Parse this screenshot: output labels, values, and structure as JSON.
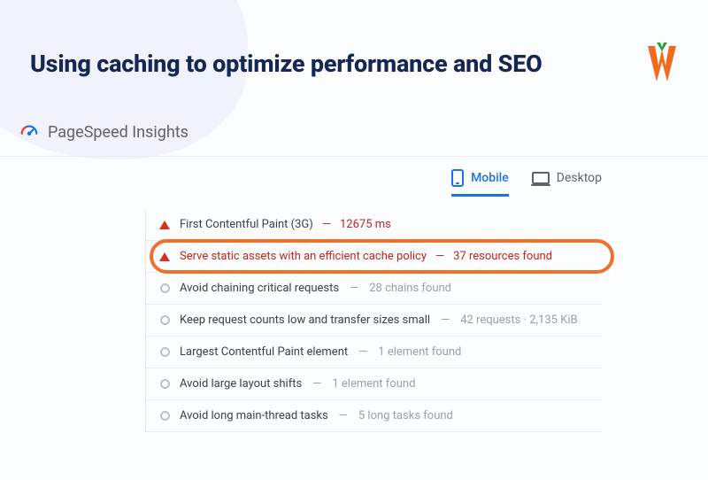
{
  "title": "Using caching to optimize performance and SEO",
  "brand_icon": "w-carrot-icon",
  "psi": {
    "label": "PageSpeed Insights",
    "icon": "pagespeed-icon"
  },
  "tabs": {
    "mobile": {
      "label": "Mobile",
      "active": true
    },
    "desktop": {
      "label": "Desktop",
      "active": false
    }
  },
  "audits": [
    {
      "severity": "warn",
      "title": "First Contentful Paint (3G)",
      "detail": "12675 ms",
      "detail_style": "red",
      "highlighted": false
    },
    {
      "severity": "warn",
      "title": "Serve static assets with an efficient cache policy",
      "detail": "37 resources found",
      "detail_style": "red",
      "highlighted": true
    },
    {
      "severity": "info",
      "title": "Avoid chaining critical requests",
      "detail": "28 chains found",
      "detail_style": "dim",
      "highlighted": false
    },
    {
      "severity": "info",
      "title": "Keep request counts low and transfer sizes small",
      "detail": "42 requests · 2,135 KiB",
      "detail_style": "dim",
      "highlighted": false
    },
    {
      "severity": "info",
      "title": "Largest Contentful Paint element",
      "detail": "1 element found",
      "detail_style": "dim",
      "highlighted": false
    },
    {
      "severity": "info",
      "title": "Avoid large layout shifts",
      "detail": "1 element found",
      "detail_style": "dim",
      "highlighted": false
    },
    {
      "severity": "info",
      "title": "Avoid long main-thread tasks",
      "detail": "5 long tasks found",
      "detail_style": "dim",
      "highlighted": false
    }
  ]
}
